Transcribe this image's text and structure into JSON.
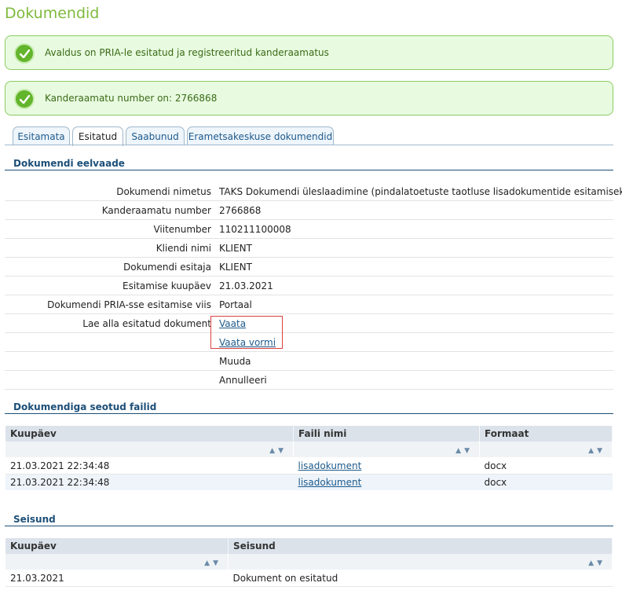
{
  "page": {
    "title": "Dokumendid"
  },
  "messages": [
    {
      "text": "Avaldus on PRIA-le esitatud ja registreeritud kanderaamatus"
    },
    {
      "text": "Kanderaamatu number on: 2766868"
    }
  ],
  "tabs": [
    {
      "label": "Esitamata",
      "active": false
    },
    {
      "label": "Esitatud",
      "active": true
    },
    {
      "label": "Saabunud",
      "active": false
    },
    {
      "label": "Erametsakeskuse dokumendid",
      "active": false
    }
  ],
  "preview": {
    "title": "Dokumendi eelvaade",
    "fields": [
      {
        "label": "Dokumendi nimetus",
        "value": "TAKS Dokumendi üleslaadimine (pindalatoetuste taotluse lisadokumentide esitamiseks)"
      },
      {
        "label": "Kanderaamatu number",
        "value": "2766868"
      },
      {
        "label": "Viitenumber",
        "value": "110211100008"
      },
      {
        "label": "Kliendi nimi",
        "value": "KLIENT"
      },
      {
        "label": "Dokumendi esitaja",
        "value": "KLIENT"
      },
      {
        "label": "Esitamise kuupäev",
        "value": "21.03.2021"
      },
      {
        "label": "Dokumendi PRIA-sse esitamise viis",
        "value": "Portaal"
      },
      {
        "label": "Lae alla esitatud dokument",
        "value": "Vaata"
      }
    ],
    "links": {
      "view_form": "Vaata vormi"
    },
    "actions": {
      "modify": "Muuda",
      "cancel": "Annulleeri"
    }
  },
  "files": {
    "title": "Dokumendiga seotud failid",
    "columns": [
      "Kuupäev",
      "Faili nimi",
      "Formaat"
    ],
    "rows": [
      {
        "date": "21.03.2021 22:34:48",
        "name": "lisadokument",
        "format": "docx"
      },
      {
        "date": "21.03.2021 22:34:48",
        "name": "lisadokument",
        "format": "docx"
      }
    ]
  },
  "status": {
    "title": "Seisund",
    "columns": [
      "Kuupäev",
      "Seisund"
    ],
    "rows": [
      {
        "date": "21.03.2021",
        "state": "Dokument on esitatud"
      }
    ]
  },
  "icons": {
    "sort": "sort-arrows-icon",
    "check": "check-icon"
  },
  "colors": {
    "accent": "#7fba3c",
    "section": "#1d4f78",
    "link": "#1d5a8c",
    "highlight": "#d94141"
  }
}
